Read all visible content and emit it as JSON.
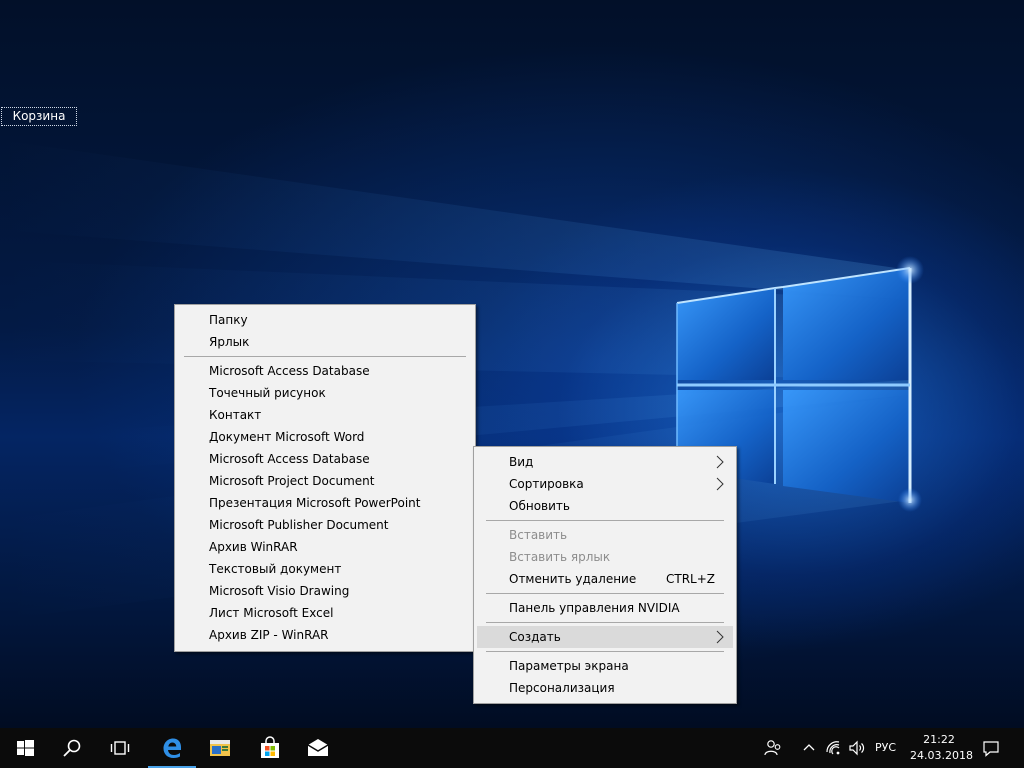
{
  "desktop": {
    "icons": [
      {
        "label": "Корзина"
      }
    ]
  },
  "context_menu": {
    "items": [
      {
        "label": "Вид",
        "submenu": true
      },
      {
        "label": "Сортировка",
        "submenu": true
      },
      {
        "label": "Обновить"
      },
      {
        "label": "Вставить",
        "disabled": true
      },
      {
        "label": "Вставить ярлык",
        "disabled": true
      },
      {
        "label": "Отменить удаление",
        "shortcut": "CTRL+Z"
      },
      {
        "label": "Панель управления NVIDIA"
      },
      {
        "label": "Создать",
        "submenu": true,
        "highlighted": true
      },
      {
        "label": "Параметры экрана"
      },
      {
        "label": "Персонализация"
      }
    ]
  },
  "create_submenu": {
    "items": [
      {
        "label": "Папку"
      },
      {
        "label": "Ярлык"
      },
      {
        "label": "Microsoft Access Database"
      },
      {
        "label": "Точечный рисунок"
      },
      {
        "label": "Контакт"
      },
      {
        "label": "Документ Microsoft Word"
      },
      {
        "label": "Microsoft Access Database"
      },
      {
        "label": "Microsoft Project Document"
      },
      {
        "label": "Презентация Microsoft PowerPoint"
      },
      {
        "label": "Microsoft Publisher Document"
      },
      {
        "label": "Архив WinRAR"
      },
      {
        "label": "Текстовый документ"
      },
      {
        "label": "Microsoft Visio Drawing"
      },
      {
        "label": "Лист Microsoft Excel"
      },
      {
        "label": "Архив ZIP - WinRAR"
      }
    ]
  },
  "taskbar": {
    "pinned": [
      "start-icon",
      "search-icon",
      "task-view-icon",
      "edge-icon",
      "file-explorer-icon",
      "store-icon",
      "mail-icon"
    ],
    "tray": {
      "language": "РУС",
      "time": "21:22",
      "date": "24.03.2018"
    }
  },
  "colors": {
    "accent": "#4aa3ea",
    "menu_background": "#f2f2f2",
    "menu_highlight": "#dadada",
    "taskbar": "#0b0b0b"
  }
}
